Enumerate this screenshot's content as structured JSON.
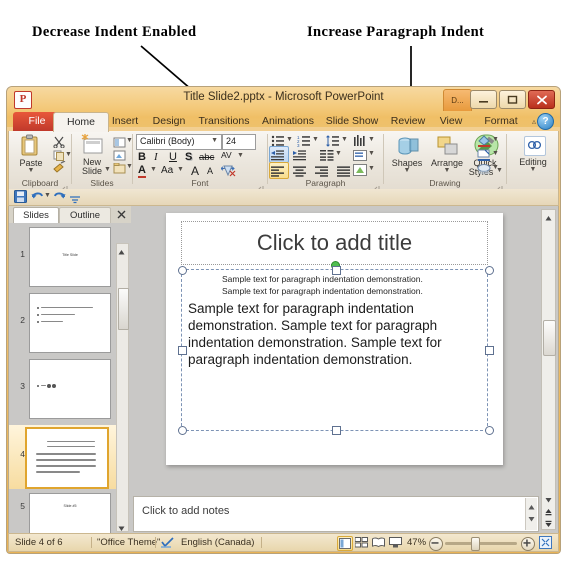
{
  "annotations": {
    "left": "Decrease Indent Enabled",
    "right": "Increase Paragraph Indent"
  },
  "window": {
    "title": "Title Slide2.pptx  -  Microsoft PowerPoint",
    "logo": "P",
    "contextual_tab": "D...",
    "controls": {
      "minimize": "minimize-icon",
      "restore": "restore-icon",
      "close": "close-icon"
    }
  },
  "tabs": [
    {
      "label": "File",
      "state": "file"
    },
    {
      "label": "Home",
      "state": "active"
    },
    {
      "label": "Insert",
      "state": "normal"
    },
    {
      "label": "Design",
      "state": "normal"
    },
    {
      "label": "Transitions",
      "state": "normal"
    },
    {
      "label": "Animations",
      "state": "normal"
    },
    {
      "label": "Slide Show",
      "state": "normal"
    },
    {
      "label": "Review",
      "state": "normal"
    },
    {
      "label": "View",
      "state": "normal"
    },
    {
      "label": "Format",
      "state": "normal"
    }
  ],
  "help_button": "?",
  "ribbon": {
    "groups": [
      {
        "name": "Clipboard",
        "label": "Clipboard"
      },
      {
        "name": "Slides",
        "label": "Slides"
      },
      {
        "name": "Font",
        "label": "Font"
      },
      {
        "name": "Paragraph",
        "label": "Paragraph"
      },
      {
        "name": "Drawing",
        "label": "Drawing"
      },
      {
        "name": "Editing",
        "label": "Editing"
      }
    ],
    "clipboard": {
      "paste": "Paste",
      "cut": "cut-icon",
      "copy": "copy-icon",
      "format_painter": "format-painter-icon"
    },
    "slides": {
      "new_slide": "New\nSlide",
      "new_slide_line1": "New",
      "new_slide_line2": "Slide",
      "layout": "layout-icon",
      "reset": "reset-icon",
      "section": "section-icon"
    },
    "font": {
      "font_name": "Calibri (Body)",
      "font_size": "24",
      "bold": "B",
      "italic": "I",
      "underline": "U",
      "shadow": "S",
      "strikethrough": "abc",
      "character_spacing": "AV",
      "font_color": "A",
      "change_case": "Aa",
      "grow_font": "A",
      "shrink_font": "A",
      "clear_formatting": "clear-formatting-icon"
    },
    "paragraph": {
      "bullets": "bullets-icon",
      "numbering": "numbering-icon",
      "line_spacing": "line-spacing-icon",
      "text_direction": "text-direction-icon",
      "decrease_indent": "decrease-indent-icon",
      "increase_indent": "increase-indent-icon",
      "columns": "columns-icon",
      "align_text": "align-text-icon",
      "align_left": "align-left-icon",
      "align_center": "align-center-icon",
      "align_right": "align-right-icon",
      "justify": "justify-icon",
      "smartart": "convert-to-smartart-icon"
    },
    "drawing": {
      "shapes": "Shapes",
      "arrange": "Arrange",
      "quick_styles_line1": "Quick",
      "quick_styles_line2": "Styles",
      "shape_fill": "shape-fill-icon",
      "shape_outline": "shape-outline-icon",
      "shape_effects": "shape-effects-icon"
    },
    "editing": {
      "label": "Editing",
      "icon": "find-replace-icon"
    }
  },
  "quick_access": {
    "save": "save-icon",
    "undo": "undo-icon",
    "redo": "redo-icon",
    "customize": "customize-icon"
  },
  "left_pane": {
    "tab_slides": "Slides",
    "tab_outline": "Outline",
    "close": "×",
    "thumbnails": [
      {
        "number": "1",
        "kind": "title",
        "caption": "Title Slide",
        "selected": false
      },
      {
        "number": "2",
        "kind": "bullets",
        "selected": false
      },
      {
        "number": "3",
        "kind": "short",
        "selected": false
      },
      {
        "number": "4",
        "kind": "paragraph",
        "selected": true
      },
      {
        "number": "5",
        "kind": "title",
        "caption": "Slide #5",
        "selected": false
      }
    ]
  },
  "slide": {
    "title_placeholder": "Click to add title",
    "body_small_lines": [
      "Sample text for paragraph indentation demonstration.",
      "Sample text for paragraph indentation demonstration."
    ],
    "body_paragraph": "Sample text for paragraph indentation demonstration. Sample text for paragraph indentation demonstration. Sample text for paragraph indentation demonstration."
  },
  "notes": {
    "placeholder": "Click to add notes"
  },
  "status_bar": {
    "slide_counter": "Slide 4 of 6",
    "theme": "\"Office Theme\"",
    "spellcheck": "spellcheck-icon",
    "language": "English (Canada)",
    "views": [
      "normal-view-icon",
      "slide-sorter-icon",
      "reading-view-icon",
      "slideshow-icon"
    ],
    "zoom_level": "47%",
    "zoom_out": "−",
    "zoom_in": "+",
    "fit_to_window": "fit-to-window-icon"
  },
  "colors": {
    "accent_orange": "#e9b254",
    "file_tab_red": "#c0392b",
    "selection_blue": "#7d93b5",
    "highlight_gold": "#f8dd8c",
    "highlight_blue": "#bcd6f2"
  }
}
